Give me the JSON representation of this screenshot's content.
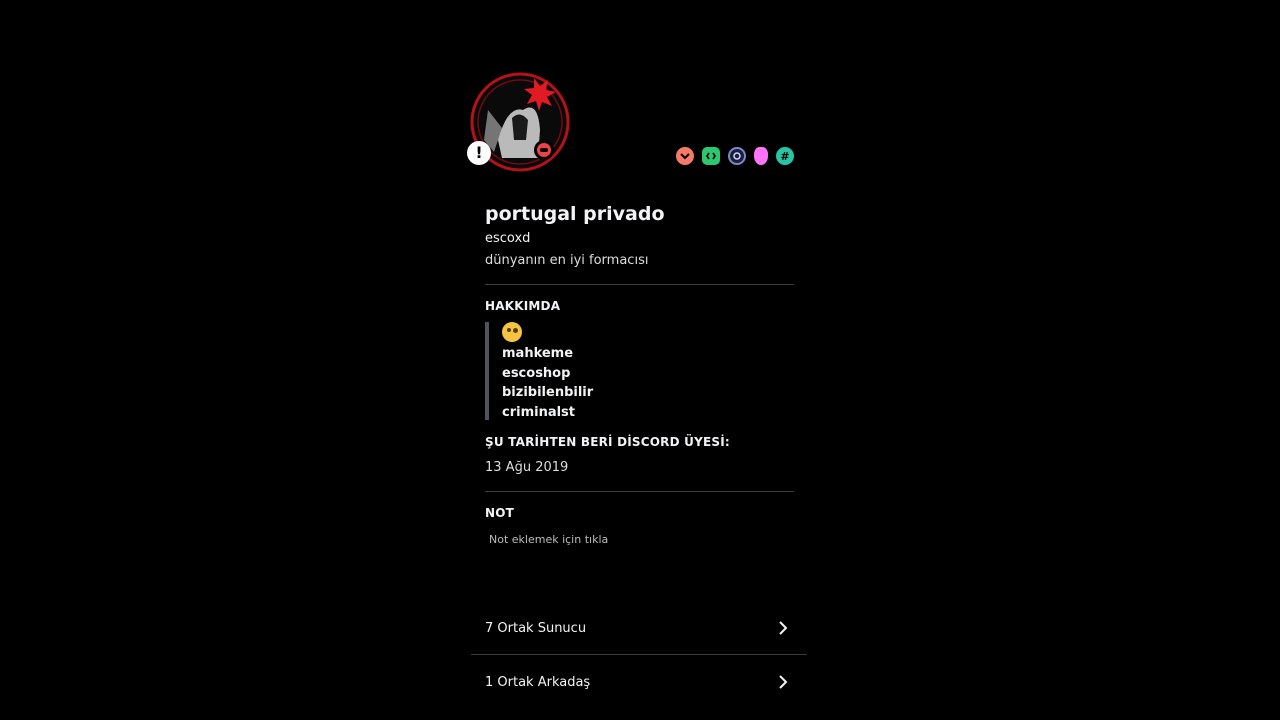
{
  "profile": {
    "display_name": "portugal privado",
    "username": "escoxd",
    "custom_status": "dünyanın en iyi formacısı",
    "avatar_alert": "!"
  },
  "badges": [
    {
      "icon": "heart-badge-icon",
      "color": "#f47b67"
    },
    {
      "icon": "active-developer-badge-icon",
      "color": "#2dc770"
    },
    {
      "icon": "quest-badge-icon",
      "color": "#7c89c7"
    },
    {
      "icon": "nitro-gem-badge-icon",
      "color": "#ff73fa"
    },
    {
      "icon": "hashtag-badge-icon",
      "color": "#27c4a5",
      "glyph": "#"
    }
  ],
  "about": {
    "title": "HAKKIMDA",
    "lines": [
      "mahkeme",
      "escoshop",
      "bizibilenbilir",
      "criminalst"
    ]
  },
  "member_since": {
    "title": "ŞU TARİHTEN BERİ DİSCORD ÜYESİ:",
    "date": "13 Ağu 2019"
  },
  "note": {
    "title": "NOT",
    "placeholder": "Not eklemek için tıkla"
  },
  "mutuals": {
    "servers_label": "7 Ortak Sunucu",
    "friends_label": "1 Ortak Arkadaş"
  },
  "colors": {
    "background": "#000000",
    "dnd_status": "#ed4245",
    "accent_ring": "#c0161b"
  }
}
